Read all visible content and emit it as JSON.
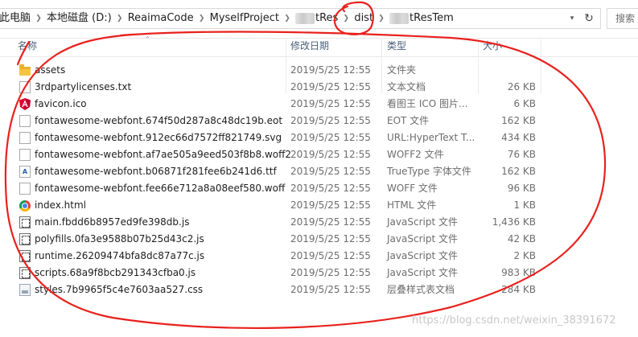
{
  "address": {
    "crumbs": [
      {
        "label": "此电脑"
      },
      {
        "label": "本地磁盘 (D:)"
      },
      {
        "label": "ReaimaCode"
      },
      {
        "label": "MyselfProject"
      },
      {
        "label": "tRes"
      },
      {
        "label": "dist"
      },
      {
        "label": "tResTem"
      }
    ],
    "search_placeholder": "搜索"
  },
  "columns": {
    "name": "名称",
    "date": "修改日期",
    "type": "类型",
    "size": "大小"
  },
  "files": [
    {
      "name": "assets",
      "date": "2019/5/25 12:55",
      "type": "文件夹",
      "size": "",
      "icon": "folder-icon"
    },
    {
      "name": "3rdpartylicenses.txt",
      "date": "2019/5/25 12:55",
      "type": "文本文档",
      "size": "26 KB",
      "icon": "text-file-icon"
    },
    {
      "name": "favicon.ico",
      "date": "2019/5/25 12:55",
      "type": "看图王 ICO 图片...",
      "size": "6 KB",
      "icon": "angular-icon"
    },
    {
      "name": "fontawesome-webfont.674f50d287a8c48dc19b.eot",
      "date": "2019/5/25 12:55",
      "type": "EOT 文件",
      "size": "162 KB",
      "icon": "blank-file-icon"
    },
    {
      "name": "fontawesome-webfont.912ec66d7572ff821749.svg",
      "date": "2019/5/25 12:55",
      "type": "URL:HyperText T...",
      "size": "434 KB",
      "icon": "blank-file-icon"
    },
    {
      "name": "fontawesome-webfont.af7ae505a9eed503f8b8.woff2",
      "date": "2019/5/25 12:55",
      "type": "WOFF2 文件",
      "size": "76 KB",
      "icon": "blank-file-icon"
    },
    {
      "name": "fontawesome-webfont.b06871f281fee6b241d6.ttf",
      "date": "2019/5/25 12:55",
      "type": "TrueType 字体文件",
      "size": "162 KB",
      "icon": "font-file-icon"
    },
    {
      "name": "fontawesome-webfont.fee66e712a8a08eef580.woff",
      "date": "2019/5/25 12:55",
      "type": "WOFF 文件",
      "size": "96 KB",
      "icon": "blank-file-icon"
    },
    {
      "name": "index.html",
      "date": "2019/5/25 12:55",
      "type": "HTML 文件",
      "size": "1 KB",
      "icon": "chrome-icon"
    },
    {
      "name": "main.fbdd6b8957ed9fe398db.js",
      "date": "2019/5/25 12:55",
      "type": "JavaScript 文件",
      "size": "1,436 KB",
      "icon": "js-file-icon"
    },
    {
      "name": "polyfills.0fa3e9588b07b25d43c2.js",
      "date": "2019/5/25 12:55",
      "type": "JavaScript 文件",
      "size": "42 KB",
      "icon": "js-file-icon"
    },
    {
      "name": "runtime.26209474bfa8dc87a77c.js",
      "date": "2019/5/25 12:55",
      "type": "JavaScript 文件",
      "size": "2 KB",
      "icon": "js-file-icon"
    },
    {
      "name": "scripts.68a9f8bcb291343cfba0.js",
      "date": "2019/5/25 12:55",
      "type": "JavaScript 文件",
      "size": "983 KB",
      "icon": "js-file-icon"
    },
    {
      "name": "styles.7b9965f5c4e7603aa527.css",
      "date": "2019/5/25 12:55",
      "type": "层叠样式表文档",
      "size": "284 KB",
      "icon": "css-file-icon"
    }
  ],
  "watermark": "https://blog.csdn.net/weixin_38391672",
  "annotation_color": "#e8211d"
}
